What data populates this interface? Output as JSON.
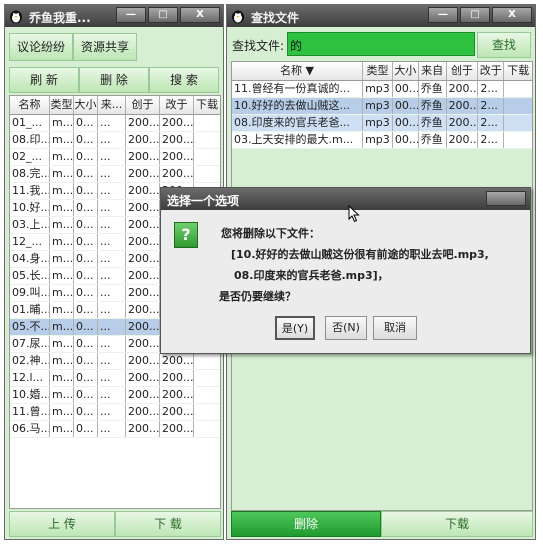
{
  "left_window": {
    "title": "乔鱼我重...",
    "tabs": [
      "议论纷纷",
      "资源共享"
    ],
    "toolbar": {
      "refresh": "刷 新",
      "delete": "删 除",
      "search": "搜 索"
    },
    "columns": [
      "名称",
      "类型",
      "大小",
      "来...",
      "创于",
      "改于",
      "下载"
    ],
    "rows": [
      [
        "01_...",
        "m...",
        "0...",
        "...",
        "200...",
        "200..."
      ],
      [
        "08.印...",
        "m...",
        "0...",
        "...",
        "200...",
        "200..."
      ],
      [
        "02_...",
        "m...",
        "0...",
        "...",
        "200...",
        "200..."
      ],
      [
        "08.完...",
        "m...",
        "0...",
        "...",
        "200...",
        "200..."
      ],
      [
        "11.我...",
        "m...",
        "0...",
        "...",
        "200...",
        "200..."
      ],
      [
        "10.好...",
        "m...",
        "0...",
        "...",
        "200...",
        "200..."
      ],
      [
        "03.上...",
        "m...",
        "0...",
        "...",
        "200...",
        "200..."
      ],
      [
        "12_...",
        "m...",
        "0...",
        "...",
        "200...",
        "200..."
      ],
      [
        "04.身...",
        "m...",
        "0...",
        "...",
        "200...",
        "200..."
      ],
      [
        "05.长...",
        "m...",
        "0...",
        "...",
        "200...",
        "200..."
      ],
      [
        "09.叫...",
        "m...",
        "0...",
        "...",
        "200...",
        "200..."
      ],
      [
        "01.晡...",
        "m...",
        "0...",
        "...",
        "200...",
        "200..."
      ],
      [
        "05.不...",
        "m...",
        "0...",
        "...",
        "200...",
        "200..."
      ],
      [
        "07.尿...",
        "m...",
        "0...",
        "...",
        "200...",
        "200..."
      ],
      [
        "02.神...",
        "m...",
        "0...",
        "...",
        "200...",
        "200..."
      ],
      [
        "12.l...",
        "m...",
        "0...",
        "...",
        "200...",
        "200..."
      ],
      [
        "10.婚...",
        "m...",
        "0...",
        "...",
        "200...",
        "200..."
      ],
      [
        "11.曾...",
        "m...",
        "0...",
        "...",
        "200...",
        "200..."
      ],
      [
        "06.马...",
        "m...",
        "0...",
        "...",
        "200...",
        "200..."
      ]
    ],
    "selected_row": 12,
    "bottom": {
      "upload": "上 传",
      "download": "下 载"
    }
  },
  "right_window": {
    "title": "查找文件",
    "search_label": "查找文件:",
    "search_value": "的",
    "search_button": "查找",
    "columns": [
      "名称 ▼",
      "类型",
      "大小",
      "来自",
      "创于",
      "改于",
      "下载"
    ],
    "rows": [
      [
        "11.曾经有一份真诚的...",
        "mp3",
        "00...",
        "乔鱼",
        "200...",
        "2..."
      ],
      [
        "10.好好的去做山贼这...",
        "mp3",
        "00...",
        "乔鱼",
        "200...",
        "2..."
      ],
      [
        "08.印度来的官兵老爸...",
        "mp3",
        "00...",
        "乔鱼",
        "200...",
        "2..."
      ],
      [
        "03.上天安排的最大.m...",
        "mp3",
        "00...",
        "乔鱼",
        "200...",
        "2..."
      ]
    ],
    "bottom": {
      "delete": "删除",
      "download": "下载"
    }
  },
  "dialog": {
    "title": "选择一个选项",
    "line1": "您将删除以下文件：",
    "line2": "[10.好好的去做山贼这份很有前途的职业去吧.mp3,",
    "line3": "08.印度来的官兵老爸.mp3]，",
    "line4": "是否仍要继续？",
    "yes": "是(Y)",
    "no": "否(N)",
    "cancel": "取消"
  },
  "win_controls": {
    "min": "—",
    "max": "□",
    "close": "X"
  }
}
